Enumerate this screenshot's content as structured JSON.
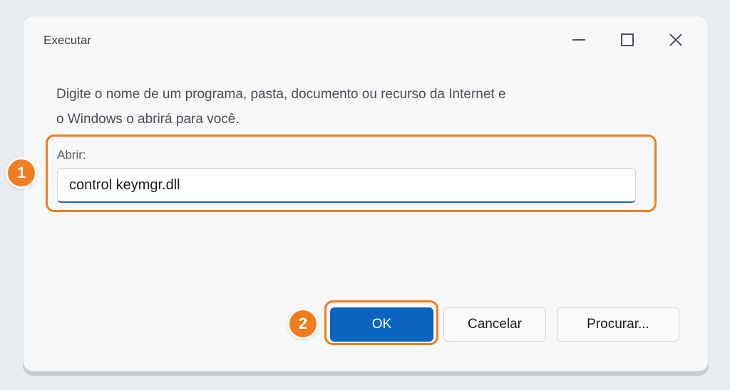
{
  "window": {
    "title": "Executar",
    "controls": {
      "minimize": "minimize-icon",
      "maximize": "maximize-icon",
      "close": "close-icon"
    }
  },
  "description": "Digite o nome de um programa, pasta, documento ou recurso da Internet e o Windows o abrirá para você.",
  "open_field": {
    "label": "Abrir:",
    "value": "control keymgr.dll"
  },
  "buttons": {
    "ok": "OK",
    "cancel": "Cancelar",
    "browse": "Procurar..."
  },
  "callouts": [
    "1",
    "2"
  ],
  "colors": {
    "highlight": "#f07d1e",
    "primary_button": "#0a64c0",
    "input_focus": "#1f66b8"
  }
}
